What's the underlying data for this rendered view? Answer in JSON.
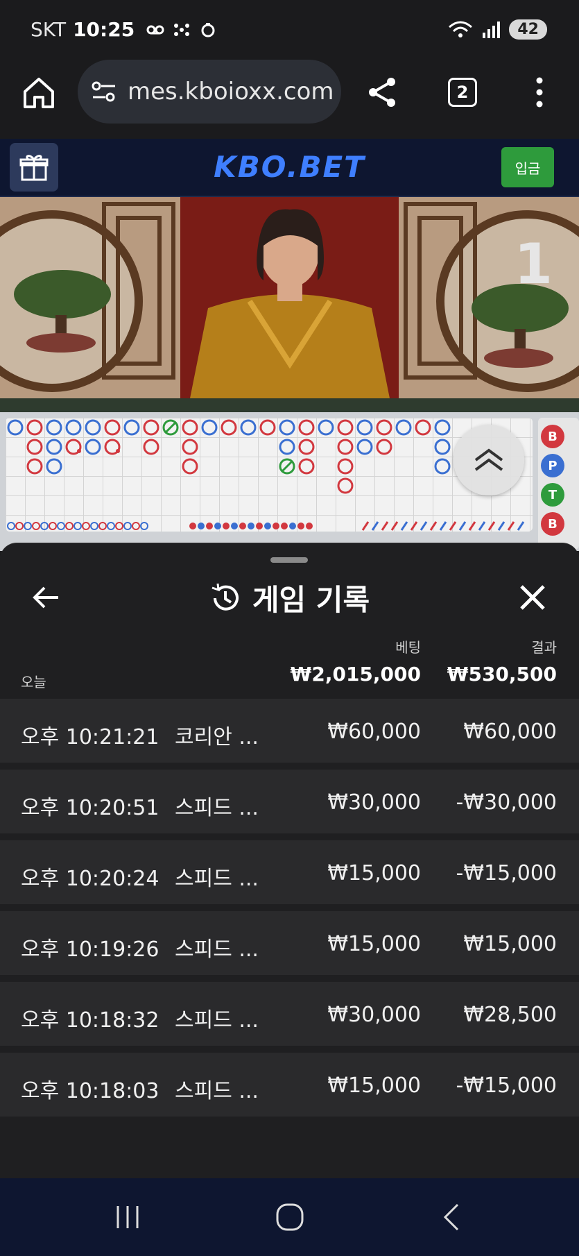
{
  "status_bar": {
    "carrier": "SKT",
    "time": "10:25",
    "battery": "42",
    "icons": [
      "voicemail-icon",
      "network-icon",
      "privacy-icon",
      "wifi-icon",
      "signal-icon"
    ]
  },
  "browser": {
    "url": "mes.kboioxx.com",
    "tab_count": "2"
  },
  "site": {
    "logo": "KBO.BET",
    "deposit_label": "입금"
  },
  "video": {
    "round_number": "1"
  },
  "roadmap": {
    "side_labels": [
      "B",
      "P",
      "T",
      "B"
    ],
    "colors": {
      "banker": "#d2383f",
      "player": "#3a6fd1",
      "tie": "#2e9b3c"
    }
  },
  "panel": {
    "title": "게임 기록",
    "col_bet": "베팅",
    "col_result": "결과",
    "today_label": "오늘",
    "total_bet": "₩2,015,000",
    "total_result": "₩530,500",
    "rows": [
      {
        "time": "오후 10:21:21",
        "game": "코리안 ...",
        "bet": "₩60,000",
        "result": "₩60,000"
      },
      {
        "time": "오후 10:20:51",
        "game": "스피드 ...",
        "bet": "₩30,000",
        "result": "-₩30,000"
      },
      {
        "time": "오후 10:20:24",
        "game": "스피드 ...",
        "bet": "₩15,000",
        "result": "-₩15,000"
      },
      {
        "time": "오후 10:19:26",
        "game": "스피드 ...",
        "bet": "₩15,000",
        "result": "₩15,000"
      },
      {
        "time": "오후 10:18:32",
        "game": "스피드 ...",
        "bet": "₩30,000",
        "result": "₩28,500"
      },
      {
        "time": "오후 10:18:03",
        "game": "스피드 ...",
        "bet": "₩15,000",
        "result": "-₩15,000"
      }
    ]
  }
}
